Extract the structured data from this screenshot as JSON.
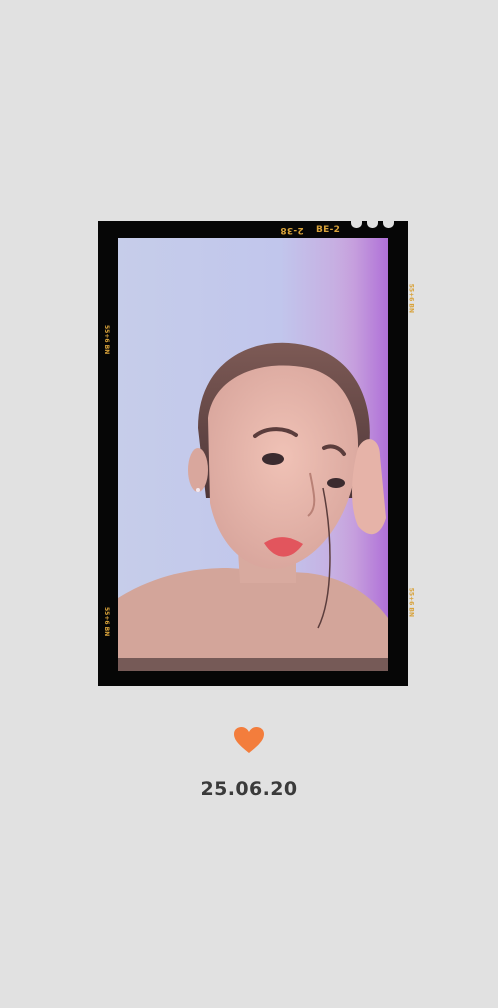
{
  "photo": {
    "edge_code_left": "2-38",
    "edge_code_right": "BE-2",
    "side_code": "55+6 BN"
  },
  "date": "25.06.20",
  "colors": {
    "background": "#e1e1e1",
    "frame": "#060606",
    "heart": "#f37d3c",
    "film_text": "#d8a23a"
  }
}
